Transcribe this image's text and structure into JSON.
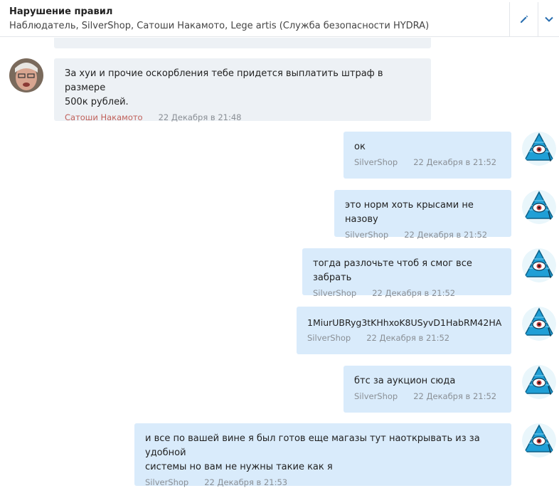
{
  "header": {
    "title": "Нарушение правил",
    "participants": "Наблюдатель, SilverShop, Сатоши Накамото, Lege artis (Служба безопасности HYDRA)"
  },
  "messages": [
    {
      "side": "in",
      "text": "За хуи и прочие оскорбления тебе придется выплатить штраф в размере\n500к рублей.",
      "author": "Сатоши Накамото",
      "time": "22 Декабря в 21:48"
    },
    {
      "side": "out",
      "text": "ок",
      "author": "SilverShop",
      "time": "22 Декабря в 21:52"
    },
    {
      "side": "out",
      "text": "это норм хоть крысами не назову",
      "author": "SilverShop",
      "time": "22 Декабря в 21:52"
    },
    {
      "side": "out",
      "text": "тогда разлочьте чтоб я смог все забрать",
      "author": "SilverShop",
      "time": "22 Декабря в 21:52"
    },
    {
      "side": "out",
      "text": "1MiurUBRyg3tKHhxoK8USyvD1HabRM42HA",
      "author": "SilverShop",
      "time": "22 Декабря в 21:52"
    },
    {
      "side": "out",
      "text": "бтс за аукцион сюда",
      "author": "SilverShop",
      "time": "22 Декабря в 21:52"
    },
    {
      "side": "out",
      "text": "и все по вашей вине я был готов еще магазы тут наоткрывать из за удобной\nсистемы но вам не нужны такие как я",
      "author": "SilverShop",
      "time": "22 Декабря в 21:53"
    }
  ],
  "colors": {
    "incoming_bubble": "#edf1f5",
    "outgoing_bubble": "#d9ebfb",
    "incoming_author": "#c0605a",
    "accent": "#2a6fb0"
  },
  "icons": {
    "edit": "pencil-icon",
    "more": "chevron-down-icon",
    "avatar_out": "pyramid-eye-avatar",
    "avatar_in": "person-photo-avatar"
  }
}
